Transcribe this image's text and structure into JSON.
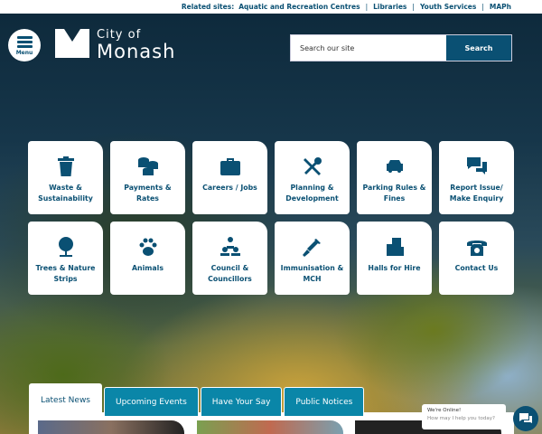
{
  "related": {
    "label": "Related sites:",
    "links": [
      "Aquatic and Recreation Centres",
      "Libraries",
      "Youth Services",
      "MAPh"
    ]
  },
  "header": {
    "menu_label": "Menu",
    "logo_line1": "City of",
    "logo_line2": "Monash",
    "search_placeholder": "Search our site",
    "search_button": "Search"
  },
  "tiles": [
    {
      "label": "Waste & Sustainability",
      "icon": "trash-icon"
    },
    {
      "label": "Payments & Rates",
      "icon": "coins-icon"
    },
    {
      "label": "Careers / Jobs",
      "icon": "briefcase-icon"
    },
    {
      "label": "Planning & Development",
      "icon": "tools-icon"
    },
    {
      "label": "Parking Rules & Fines",
      "icon": "car-icon"
    },
    {
      "label": "Report Issue/ Make Enquiry",
      "icon": "chat-bubbles-icon"
    },
    {
      "label": "Trees & Nature Strips",
      "icon": "tree-icon"
    },
    {
      "label": "Animals",
      "icon": "paw-icon"
    },
    {
      "label": "Council & Councillors",
      "icon": "people-icon"
    },
    {
      "label": "Immunisation & MCH",
      "icon": "syringe-icon"
    },
    {
      "label": "Halls for Hire",
      "icon": "building-icon"
    },
    {
      "label": "Contact Us",
      "icon": "phone-icon"
    }
  ],
  "tabs": [
    "Latest News",
    "Upcoming Events",
    "Have Your Say",
    "Public Notices"
  ],
  "chat": {
    "title": "We're Online!",
    "subtitle": "How may I help you today?"
  },
  "colors": {
    "brand": "#0a5073",
    "tab": "#0a86a8"
  }
}
